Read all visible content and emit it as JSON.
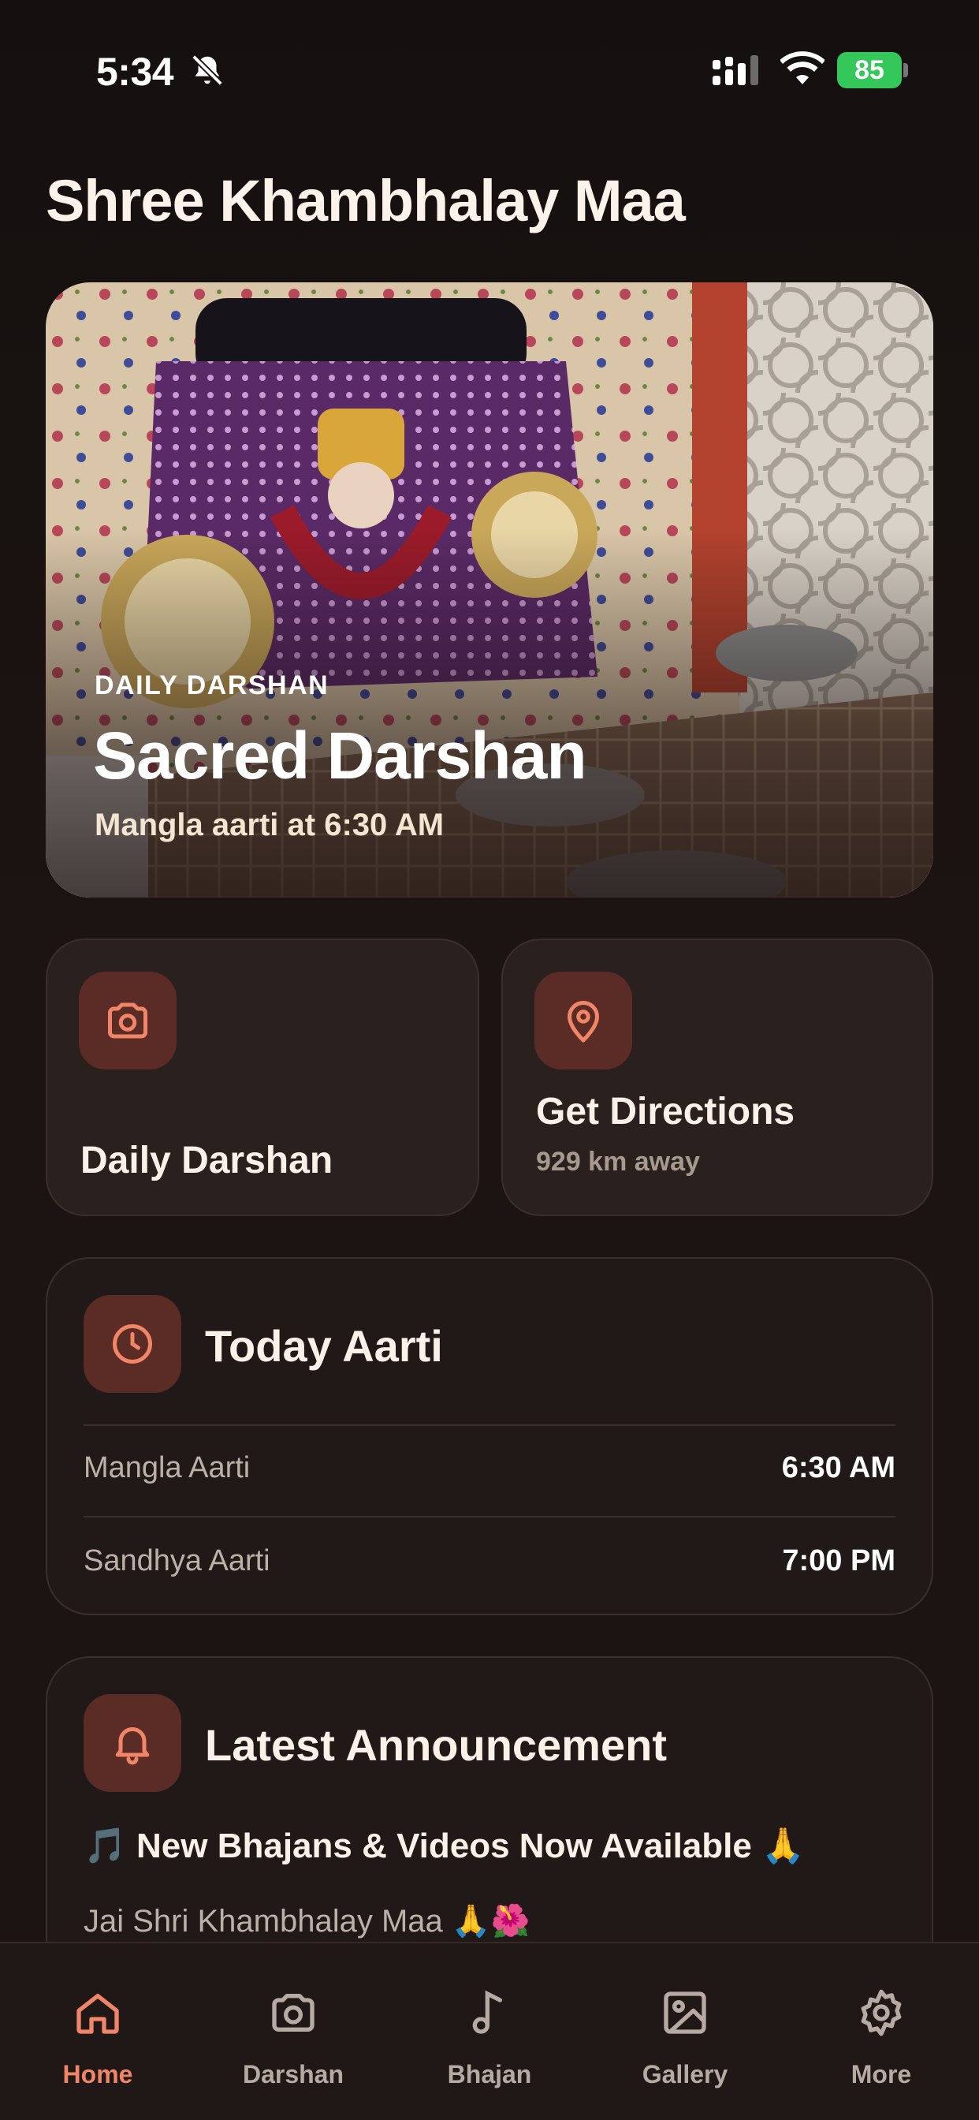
{
  "status_bar": {
    "time": "5:34",
    "battery": "85"
  },
  "page": {
    "title": "Shree Khambhalay Maa"
  },
  "hero": {
    "tag": "DAILY DARSHAN",
    "title": "Sacred Darshan",
    "subtitle": "Mangla aarti at 6:30 AM"
  },
  "quick_actions": [
    {
      "label": "Daily Darshan",
      "icon": "camera-icon"
    },
    {
      "label": "Get Directions",
      "sub": "929 km away",
      "icon": "location-pin-icon"
    }
  ],
  "aarti": {
    "title": "Today Aarti",
    "rows": [
      {
        "name": "Mangla Aarti",
        "time": "6:30 AM"
      },
      {
        "name": "Sandhya Aarti",
        "time": "7:00 PM"
      }
    ]
  },
  "announcement": {
    "title": "Latest Announcement",
    "headline": "🎵 New Bhajans & Videos Now Available 🙏",
    "body": "Jai Shri Khambhalay Maa 🙏🌺"
  },
  "tabs": [
    {
      "label": "Home",
      "icon": "home-icon",
      "active": true
    },
    {
      "label": "Darshan",
      "icon": "camera-icon"
    },
    {
      "label": "Bhajan",
      "icon": "music-note-icon"
    },
    {
      "label": "Gallery",
      "icon": "image-icon"
    },
    {
      "label": "More",
      "icon": "gear-icon"
    }
  ],
  "colors": {
    "accent": "#f08568",
    "icon_tile": "#5b2c26",
    "card": "#2a211e",
    "background": "#1a1312"
  }
}
